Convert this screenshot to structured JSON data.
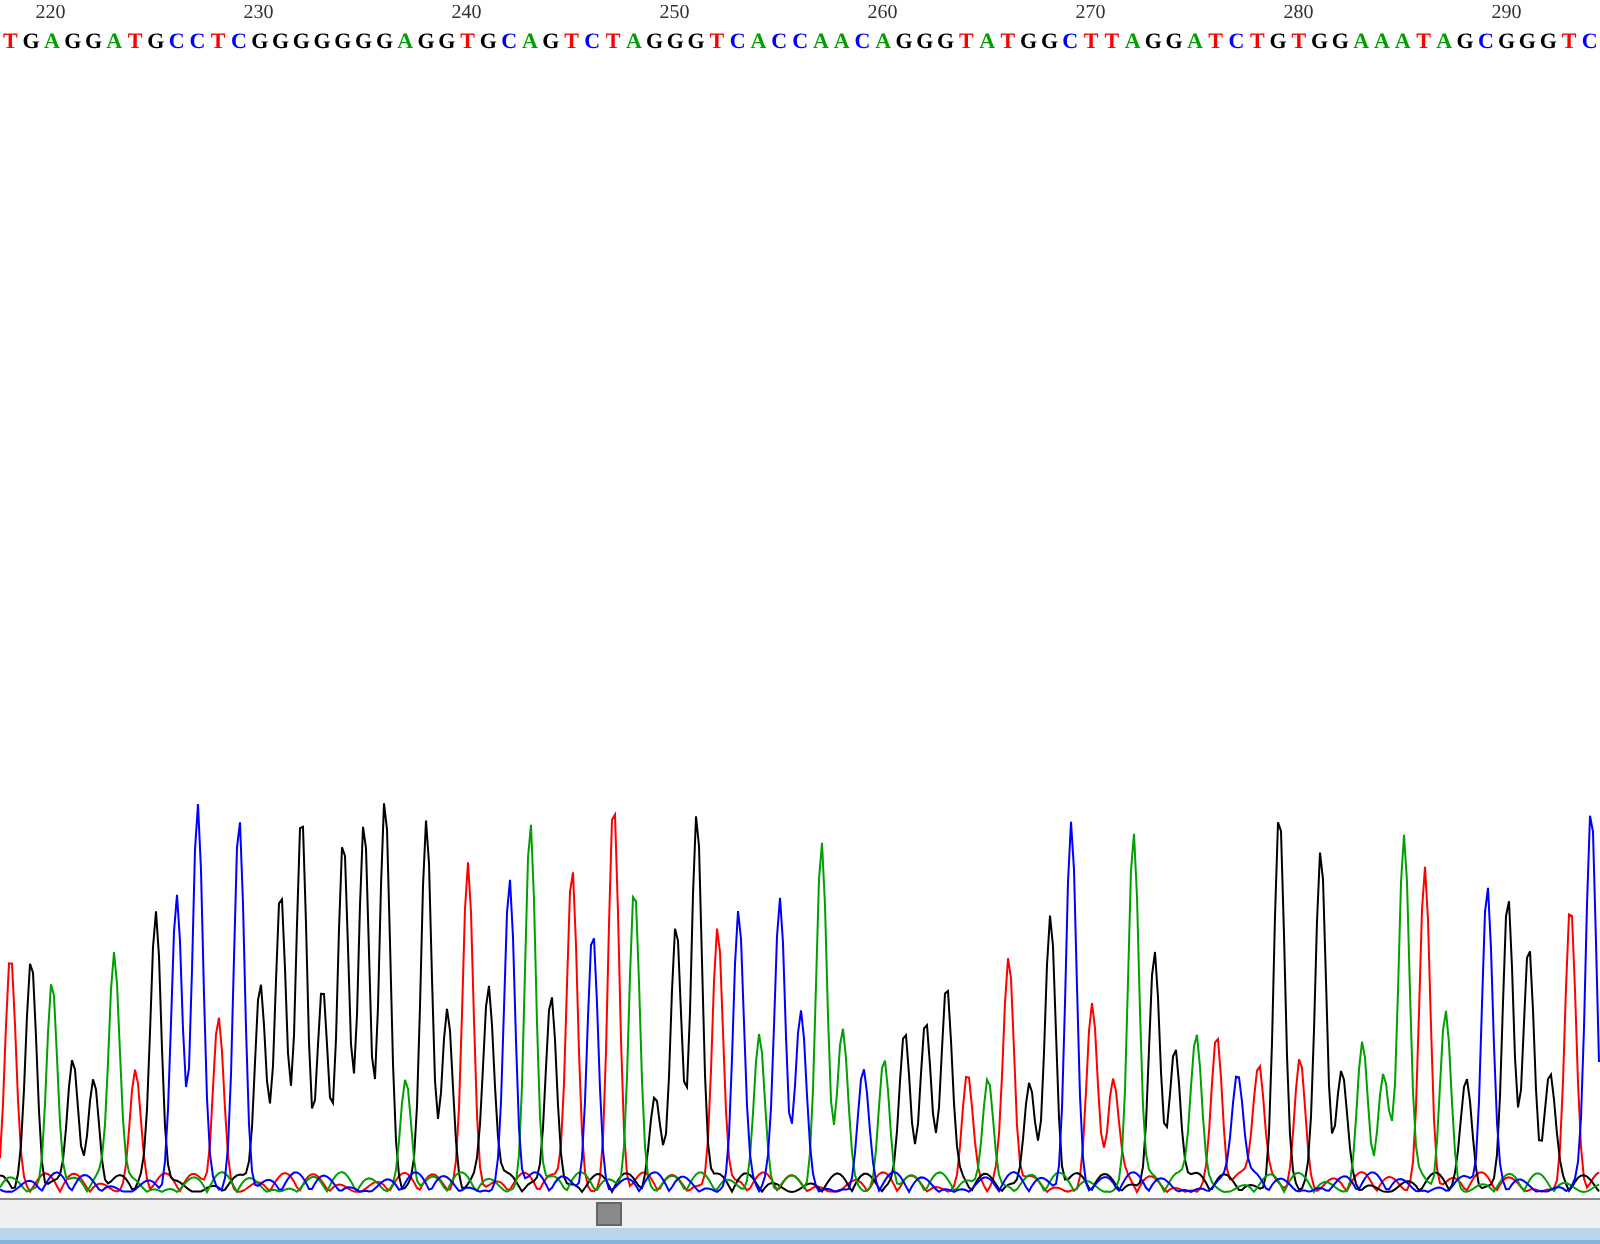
{
  "ruler": [
    {
      "label": "220"
    },
    {
      "label": "230"
    },
    {
      "label": "240"
    },
    {
      "label": "250"
    },
    {
      "label": "260"
    },
    {
      "label": "270"
    },
    {
      "label": "280"
    },
    {
      "label": "290"
    }
  ],
  "bases": [
    {
      "base": "T",
      "color": "#ff0000"
    },
    {
      "base": "G",
      "color": "#000000"
    },
    {
      "base": "A",
      "color": "#00a000"
    },
    {
      "base": "G",
      "color": "#000000"
    },
    {
      "base": "G",
      "color": "#000000"
    },
    {
      "base": "A",
      "color": "#00a000"
    },
    {
      "base": "T",
      "color": "#ff0000"
    },
    {
      "base": "G",
      "color": "#000000"
    },
    {
      "base": "C",
      "color": "#0000ff"
    },
    {
      "base": "C",
      "color": "#0000ff"
    },
    {
      "base": "T",
      "color": "#ff0000"
    },
    {
      "base": "C",
      "color": "#0000ff"
    },
    {
      "base": "G",
      "color": "#000000"
    },
    {
      "base": "G",
      "color": "#000000"
    },
    {
      "base": "G",
      "color": "#000000"
    },
    {
      "base": "G",
      "color": "#000000"
    },
    {
      "base": "G",
      "color": "#000000"
    },
    {
      "base": "G",
      "color": "#000000"
    },
    {
      "base": "G",
      "color": "#000000"
    },
    {
      "base": "A",
      "color": "#00a000"
    },
    {
      "base": "G",
      "color": "#000000"
    },
    {
      "base": "G",
      "color": "#000000"
    },
    {
      "base": "T",
      "color": "#ff0000"
    },
    {
      "base": "G",
      "color": "#000000"
    },
    {
      "base": "C",
      "color": "#0000ff"
    },
    {
      "base": "A",
      "color": "#00a000"
    },
    {
      "base": "G",
      "color": "#000000"
    },
    {
      "base": "T",
      "color": "#ff0000"
    },
    {
      "base": "C",
      "color": "#0000ff"
    },
    {
      "base": "T",
      "color": "#ff0000"
    },
    {
      "base": "A",
      "color": "#00a000"
    },
    {
      "base": "G",
      "color": "#000000"
    },
    {
      "base": "G",
      "color": "#000000"
    },
    {
      "base": "G",
      "color": "#000000"
    },
    {
      "base": "T",
      "color": "#ff0000"
    },
    {
      "base": "C",
      "color": "#0000ff"
    },
    {
      "base": "A",
      "color": "#00a000"
    },
    {
      "base": "C",
      "color": "#0000ff"
    },
    {
      "base": "C",
      "color": "#0000ff"
    },
    {
      "base": "A",
      "color": "#00a000"
    },
    {
      "base": "A",
      "color": "#00a000"
    },
    {
      "base": "C",
      "color": "#0000ff"
    },
    {
      "base": "A",
      "color": "#00a000"
    },
    {
      "base": "G",
      "color": "#000000"
    },
    {
      "base": "G",
      "color": "#000000"
    },
    {
      "base": "G",
      "color": "#000000"
    },
    {
      "base": "T",
      "color": "#ff0000"
    },
    {
      "base": "A",
      "color": "#00a000"
    },
    {
      "base": "T",
      "color": "#ff0000"
    },
    {
      "base": "G",
      "color": "#000000"
    },
    {
      "base": "G",
      "color": "#000000"
    },
    {
      "base": "C",
      "color": "#0000ff"
    },
    {
      "base": "T",
      "color": "#ff0000"
    },
    {
      "base": "T",
      "color": "#ff0000"
    },
    {
      "base": "A",
      "color": "#00a000"
    },
    {
      "base": "G",
      "color": "#000000"
    },
    {
      "base": "G",
      "color": "#000000"
    },
    {
      "base": "A",
      "color": "#00a000"
    },
    {
      "base": "T",
      "color": "#ff0000"
    },
    {
      "base": "C",
      "color": "#0000ff"
    },
    {
      "base": "T",
      "color": "#ff0000"
    },
    {
      "base": "G",
      "color": "#000000"
    },
    {
      "base": "T",
      "color": "#ff0000"
    },
    {
      "base": "G",
      "color": "#000000"
    },
    {
      "base": "G",
      "color": "#000000"
    },
    {
      "base": "A",
      "color": "#00a000"
    },
    {
      "base": "A",
      "color": "#00a000"
    },
    {
      "base": "A",
      "color": "#00a000"
    },
    {
      "base": "T",
      "color": "#ff0000"
    },
    {
      "base": "A",
      "color": "#00a000"
    },
    {
      "base": "G",
      "color": "#000000"
    },
    {
      "base": "C",
      "color": "#0000ff"
    },
    {
      "base": "G",
      "color": "#000000"
    },
    {
      "base": "G",
      "color": "#000000"
    },
    {
      "base": "G",
      "color": "#000000"
    },
    {
      "base": "T",
      "color": "#ff0000"
    },
    {
      "base": "C",
      "color": "#0000ff"
    }
  ]
}
